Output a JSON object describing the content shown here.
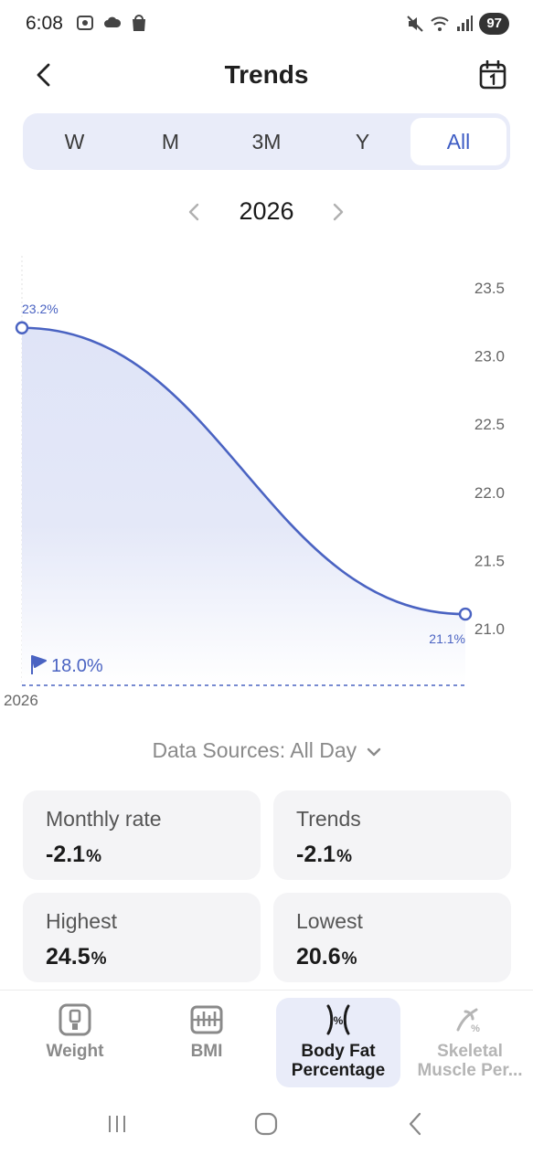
{
  "status": {
    "time": "6:08",
    "battery": "97"
  },
  "header": {
    "title": "Trends"
  },
  "period_tabs": [
    {
      "label": "W",
      "active": false
    },
    {
      "label": "M",
      "active": false
    },
    {
      "label": "3M",
      "active": false
    },
    {
      "label": "Y",
      "active": false
    },
    {
      "label": "All",
      "active": true
    }
  ],
  "year_nav": {
    "year": "2026"
  },
  "chart_data": {
    "type": "area",
    "x": [
      "start",
      "end"
    ],
    "series": [
      {
        "values": [
          23.2,
          21.1
        ]
      }
    ],
    "ylim": [
      20.6,
      23.5
    ],
    "yticks": [
      "23.5",
      "23.0",
      "22.5",
      "22.0",
      "21.5",
      "21.0"
    ],
    "point_labels": [
      "23.2%",
      "21.1%"
    ],
    "goal_label": "18.0%",
    "xlabel_tick": "2026",
    "line_color": "#4a63c2",
    "grid": false
  },
  "data_sources": {
    "label": "Data Sources: All Day"
  },
  "stats": [
    {
      "label": "Monthly rate",
      "value": "-2.1",
      "unit": "%"
    },
    {
      "label": "Trends",
      "value": "-2.1",
      "unit": "%"
    },
    {
      "label": "Highest",
      "value": "24.5",
      "unit": "%"
    },
    {
      "label": "Lowest",
      "value": "20.6",
      "unit": "%"
    }
  ],
  "bottom_nav": [
    {
      "label": "Weight",
      "icon": "scale-icon"
    },
    {
      "label": "BMI",
      "icon": "ruler-icon"
    },
    {
      "label": "Body Fat Percentage",
      "icon": "body-fat-icon",
      "active": true
    },
    {
      "label": "Skeletal Muscle Per...",
      "icon": "muscle-icon"
    }
  ],
  "colors": {
    "accent": "#3d5cc4",
    "tab_bg": "#e9ecf9",
    "card_bg": "#f4f4f6"
  }
}
